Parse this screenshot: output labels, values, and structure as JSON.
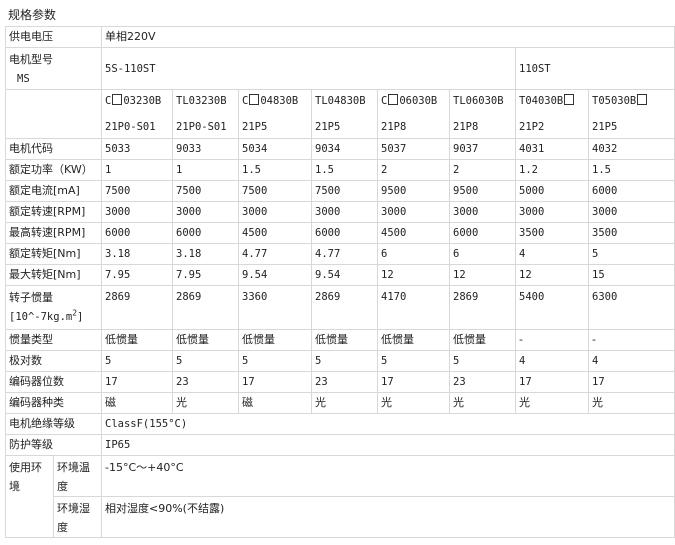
{
  "title": "规格参数",
  "rows": {
    "voltage": {
      "label": "供电电压",
      "value": "单相220V"
    },
    "model": {
      "label": "电机型号",
      "label_sub": "MS",
      "series_a": "5S-110ST",
      "series_b": "110ST"
    },
    "models_line1": [
      "C",
      "TL03230B",
      "C",
      "TL04830B",
      "C",
      "TL06030B",
      "T04030B",
      "T05030B"
    ],
    "models_line1_text": [
      "03230B",
      "TL03230B",
      "04830B",
      "TL04830B",
      "06030B",
      "TL06030B",
      "T04030B",
      "T05030B"
    ],
    "models_line2": [
      "21P0-S01",
      "21P0-S01",
      "21P5",
      "21P5",
      "21P8",
      "21P8",
      "21P2",
      "21P5"
    ],
    "code": {
      "label": "电机代码",
      "values": [
        "5033",
        "9033",
        "5034",
        "9034",
        "5037",
        "9037",
        "4031",
        "4032"
      ]
    },
    "power": {
      "label": "额定功率（KW）",
      "values": [
        "1",
        "1",
        "1.5",
        "1.5",
        "2",
        "2",
        "1.2",
        "1.5"
      ]
    },
    "current": {
      "label": "额定电流[mA]",
      "values": [
        "7500",
        "7500",
        "7500",
        "7500",
        "9500",
        "9500",
        "5000",
        "6000"
      ]
    },
    "rated_speed": {
      "label": "额定转速[RPM]",
      "values": [
        "3000",
        "3000",
        "3000",
        "3000",
        "3000",
        "3000",
        "3000",
        "3000"
      ]
    },
    "max_speed": {
      "label": "最高转速[RPM]",
      "values": [
        "6000",
        "6000",
        "4500",
        "6000",
        "4500",
        "6000",
        "3500",
        "3500"
      ]
    },
    "rated_torque": {
      "label": "额定转矩[Nm]",
      "values": [
        "3.18",
        "3.18",
        "4.77",
        "4.77",
        "6",
        "6",
        "4",
        "5"
      ]
    },
    "max_torque": {
      "label": "最大转矩[Nm]",
      "values": [
        "7.95",
        "7.95",
        "9.54",
        "9.54",
        "12",
        "12",
        "12",
        "15"
      ]
    },
    "inertia": {
      "label": "转子惯量",
      "unit_prefix": "[10^-7kg.m",
      "unit_exp": "2",
      "unit_suffix": "]",
      "values": [
        "2869",
        "2869",
        "3360",
        "2869",
        "4170",
        "2869",
        "5400",
        "6300"
      ]
    },
    "inertia_type": {
      "label": "惯量类型",
      "values": [
        "低惯量",
        "低惯量",
        "低惯量",
        "低惯量",
        "低惯量",
        "低惯量",
        "-",
        "-"
      ]
    },
    "poles": {
      "label": "极对数",
      "values": [
        "5",
        "5",
        "5",
        "5",
        "5",
        "5",
        "4",
        "4"
      ]
    },
    "encoder_bits": {
      "label": "编码器位数",
      "values": [
        "17",
        "23",
        "17",
        "23",
        "17",
        "23",
        "17",
        "17"
      ]
    },
    "encoder_type": {
      "label": "编码器种类",
      "values": [
        "磁",
        "光",
        "磁",
        "光",
        "光",
        "光",
        "光",
        "光"
      ]
    },
    "insulation": {
      "label": "电机绝缘等级",
      "value": "ClassF(155°C)"
    },
    "protection": {
      "label": "防护等级",
      "value": "IP65"
    },
    "environment": {
      "label": "使用环境",
      "temp_label": "环境温度",
      "temp_value": "-15°C～+40°C",
      "humidity_label": "环境湿度",
      "humidity_value": "相对湿度<90%(不结露)"
    }
  }
}
